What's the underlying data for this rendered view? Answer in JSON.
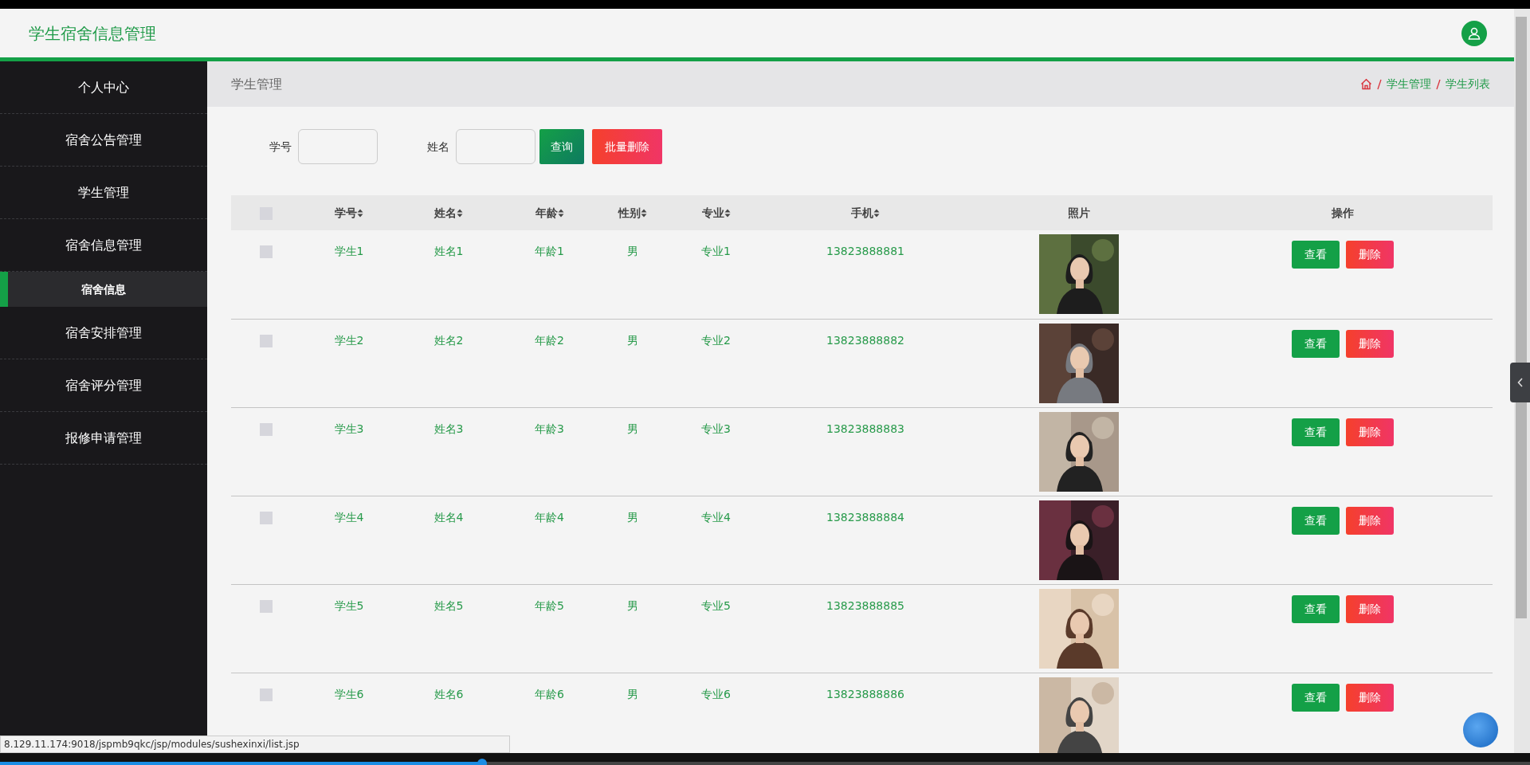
{
  "header": {
    "title": "学生宿舍信息管理"
  },
  "sidebar": {
    "items": [
      {
        "label": "个人中心",
        "selected": false
      },
      {
        "label": "宿舍公告管理",
        "selected": false
      },
      {
        "label": "学生管理",
        "selected": false
      },
      {
        "label": "宿舍信息管理",
        "selected": false,
        "children": [
          {
            "label": "宿舍信息",
            "selected": true
          }
        ]
      },
      {
        "label": "宿舍安排管理",
        "selected": false
      },
      {
        "label": "宿舍评分管理",
        "selected": false
      },
      {
        "label": "报修申请管理",
        "selected": false
      }
    ]
  },
  "page_header": {
    "title": "学生管理",
    "breadcrumb": [
      "学生管理",
      "学生列表"
    ]
  },
  "search": {
    "fields": [
      {
        "label": "学号"
      },
      {
        "label": "姓名"
      }
    ],
    "buttons": [
      {
        "label": "查询",
        "kind": "query"
      },
      {
        "label": "批量删除",
        "kind": "danger"
      }
    ]
  },
  "table": {
    "select_all": {
      "checked": false
    },
    "columns": [
      {
        "label": "学号",
        "sortable": true
      },
      {
        "label": "姓名",
        "sortable": true
      },
      {
        "label": "年龄",
        "sortable": true
      },
      {
        "label": "性别",
        "sortable": true
      },
      {
        "label": "专业",
        "sortable": true
      },
      {
        "label": "手机",
        "sortable": true
      },
      {
        "label": "照片",
        "sortable": false
      },
      {
        "label": "操作",
        "sortable": false
      }
    ],
    "rows": [
      {
        "checked": false,
        "cells": [
          "学生1",
          "姓名1",
          "年龄1",
          "男",
          "专业1",
          "13823888881"
        ],
        "photo": {
          "kind": "picture"
        },
        "actions": [
          "查看",
          "删除"
        ]
      },
      {
        "checked": false,
        "cells": [
          "学生2",
          "姓名2",
          "年龄2",
          "男",
          "专业2",
          "13823888882"
        ],
        "photo": {
          "kind": "picture"
        },
        "actions": [
          "查看",
          "删除"
        ]
      },
      {
        "checked": false,
        "cells": [
          "学生3",
          "姓名3",
          "年龄3",
          "男",
          "专业3",
          "13823888883"
        ],
        "photo": {
          "kind": "picture"
        },
        "actions": [
          "查看",
          "删除"
        ]
      },
      {
        "checked": false,
        "cells": [
          "学生4",
          "姓名4",
          "年龄4",
          "男",
          "专业4",
          "13823888884"
        ],
        "photo": {
          "kind": "picture"
        },
        "actions": [
          "查看",
          "删除"
        ]
      },
      {
        "checked": false,
        "cells": [
          "学生5",
          "姓名5",
          "年龄5",
          "男",
          "专业5",
          "13823888885"
        ],
        "photo": {
          "kind": "picture"
        },
        "actions": [
          "查看",
          "删除"
        ]
      },
      {
        "checked": false,
        "cells": [
          "学生6",
          "姓名6",
          "年龄6",
          "男",
          "专业6",
          "13823888886"
        ],
        "photo": {
          "kind": "picture"
        },
        "actions": [
          "查看",
          "删除"
        ]
      }
    ]
  },
  "status_url": "8.129.11.174:9018/jspmb9qkc/jsp/modules/sushexinxi/list.jsp",
  "video_progress": {
    "level": 0.315
  }
}
